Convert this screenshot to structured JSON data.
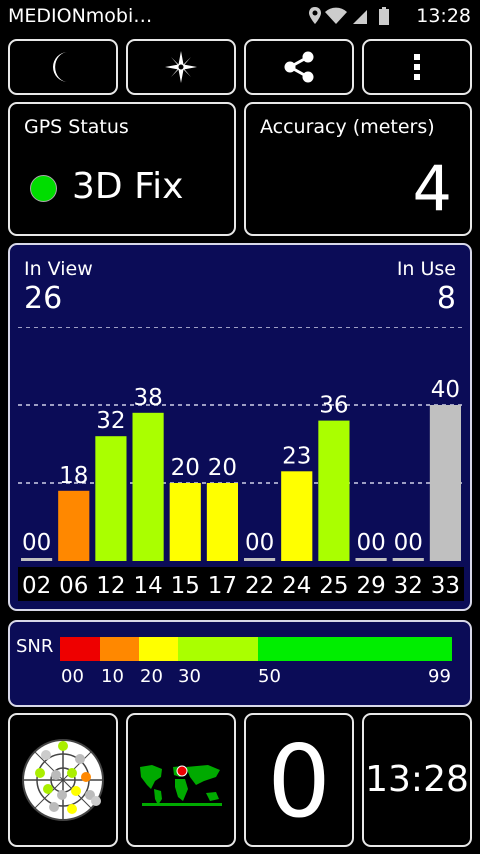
{
  "status_bar": {
    "app_name": "MEDIONmobi…",
    "time": "13:28",
    "icons": [
      "location-icon",
      "wifi-icon",
      "signal-icon",
      "battery-icon"
    ]
  },
  "toolbar": {
    "buttons": [
      "night-mode-icon",
      "compass-icon",
      "share-icon",
      "overflow-menu-icon"
    ]
  },
  "gps_status": {
    "label": "GPS Status",
    "value": "3D Fix",
    "indicator_color": "#00dd00"
  },
  "accuracy": {
    "label": "Accuracy (meters)",
    "value": "4"
  },
  "satellites": {
    "in_view_label": "In View",
    "in_view": "26",
    "in_use_label": "In Use",
    "in_use": "8"
  },
  "chart_data": {
    "type": "bar",
    "categories": [
      "02",
      "06",
      "12",
      "14",
      "15",
      "17",
      "22",
      "24",
      "25",
      "29",
      "32",
      "33"
    ],
    "values": [
      0,
      18,
      32,
      38,
      20,
      20,
      0,
      23,
      36,
      0,
      0,
      40
    ],
    "value_labels": [
      "00",
      "18",
      "32",
      "38",
      "20",
      "20",
      "00",
      "23",
      "36",
      "00",
      "00",
      "40"
    ],
    "ylim": [
      0,
      60
    ],
    "grid_values": [
      20,
      40,
      60
    ],
    "grid": true
  },
  "snr_legend": {
    "title": "SNR",
    "ticks": [
      "00",
      "10",
      "20",
      "30",
      "50",
      "99"
    ],
    "colors": [
      "#ee0000",
      "#ff8800",
      "#ffff00",
      "#aaff00",
      "#00ee00"
    ]
  },
  "bottom": {
    "clock": "13:28",
    "big_value": "0"
  }
}
